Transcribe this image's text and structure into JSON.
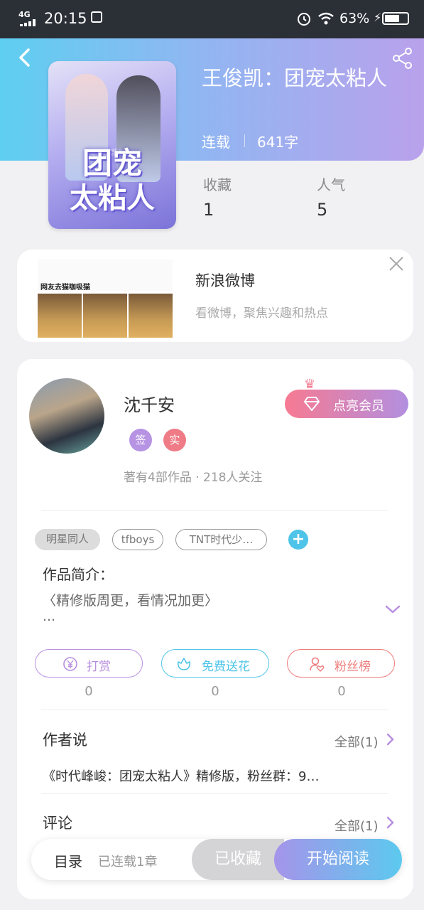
{
  "status_bar": {
    "network": "4G",
    "time": "20:15",
    "battery_pct": "63%"
  },
  "book": {
    "title": "王俊凯：团宠太粘人",
    "status": "连载",
    "words": "641字",
    "stats": [
      {
        "label": "收藏",
        "value": "1"
      },
      {
        "label": "人气",
        "value": "5"
      }
    ],
    "cover": {
      "tag": "《王俊凯》",
      "line1": "团宠",
      "line2": "太粘人"
    }
  },
  "ad": {
    "image_caption": "网友去猫咖吸猫",
    "title": "新浪微博",
    "desc": "看微博，聚焦兴趣和热点"
  },
  "author": {
    "name": "沈千安",
    "vip_label": "点亮会员",
    "badges": [
      "签",
      "实"
    ],
    "stats": "著有4部作品 · 218人关注"
  },
  "tags": [
    "明星同人",
    "tfboys",
    "TNT时代少…"
  ],
  "intro": {
    "heading": "作品简介：",
    "text": "〈精修版周更，看情况加更〉",
    "more": "…"
  },
  "actions": [
    {
      "label": "打赏",
      "count": "0",
      "color": "#b88fe0"
    },
    {
      "label": "免费送花",
      "count": "0",
      "color": "#4ec4e8"
    },
    {
      "label": "粉丝榜",
      "count": "0",
      "color": "#ee7b7b"
    }
  ],
  "author_say": {
    "heading": "作者说",
    "all": "全部(1)",
    "text": "《时代峰峻：团宠太粘人》精修版，粉丝群：9…"
  },
  "comments": {
    "heading": "评论",
    "all": "全部(1)"
  },
  "bottom": {
    "toc": "目录",
    "toc_info": "已连载1章",
    "collected": "已收藏",
    "read": "开始阅读"
  }
}
